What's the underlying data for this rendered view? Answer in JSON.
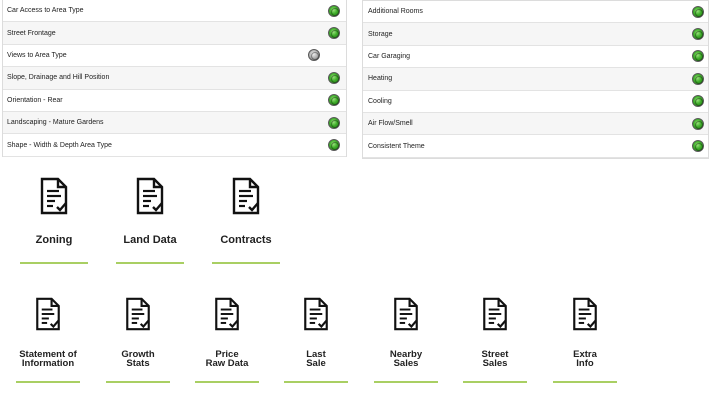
{
  "left_panel": {
    "rows": [
      {
        "label": "Car Access to Area Type",
        "status": "green"
      },
      {
        "label": "Street Frontage",
        "status": "green"
      },
      {
        "label": "Views to Area Type",
        "status": "grey"
      },
      {
        "label": "Slope, Drainage and Hill Position",
        "status": "green"
      },
      {
        "label": "Orientation - Rear",
        "status": "green"
      },
      {
        "label": "Landscaping - Mature Gardens",
        "status": "green"
      },
      {
        "label": "Shape - Width & Depth Area Type",
        "status": "green"
      }
    ]
  },
  "right_panel": {
    "rows": [
      {
        "label": "Additional Rooms",
        "status": "green"
      },
      {
        "label": "Storage",
        "status": "green"
      },
      {
        "label": "Car Garaging",
        "status": "green"
      },
      {
        "label": "Heating",
        "status": "green"
      },
      {
        "label": "Cooling",
        "status": "green"
      },
      {
        "label": "Air Flow/Smell",
        "status": "green"
      },
      {
        "label": "Consistent Theme",
        "status": "green"
      }
    ]
  },
  "top_tiles": [
    {
      "label": "Zoning",
      "icon": "document-check-icon"
    },
    {
      "label": "Land Data",
      "icon": "document-check-icon"
    },
    {
      "label": "Contracts",
      "icon": "document-check-icon"
    }
  ],
  "bottom_tiles": [
    {
      "line1": "Statement of",
      "line2": "Information",
      "icon": "document-check-icon"
    },
    {
      "line1": "Growth",
      "line2": "Stats",
      "icon": "document-check-icon"
    },
    {
      "line1": "Price",
      "line2": "Raw Data",
      "icon": "document-check-icon"
    },
    {
      "line1": "Last",
      "line2": "Sale",
      "icon": "document-check-icon"
    },
    {
      "line1": "Nearby",
      "line2": "Sales",
      "icon": "document-check-icon"
    },
    {
      "line1": "Street",
      "line2": "Sales",
      "icon": "document-check-icon"
    },
    {
      "line1": "Extra",
      "line2": "Info",
      "icon": "document-check-icon"
    }
  ],
  "colors": {
    "accent_underline": "#a9cf63",
    "status_green": "#3fae2a",
    "status_grey": "#a9a9a9"
  }
}
